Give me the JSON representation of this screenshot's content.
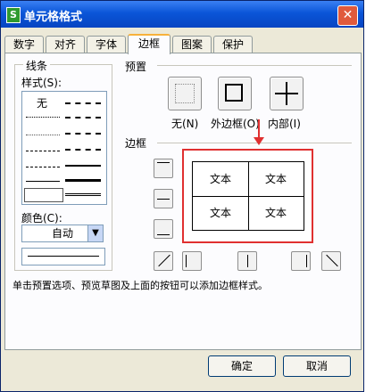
{
  "window": {
    "title": "单元格格式",
    "app_icon": "S"
  },
  "tabs": [
    "数字",
    "对齐",
    "字体",
    "边框",
    "图案",
    "保护"
  ],
  "line_group": {
    "title": "线条",
    "style_label": "样式(S):",
    "none_label": "无",
    "color_label": "颜色(C):",
    "color_value": "自动"
  },
  "presets": {
    "title": "预置",
    "none": "无(N)",
    "outline": "外边框(O)",
    "inside": "内部(I)"
  },
  "border_group": {
    "title": "边框"
  },
  "preview": {
    "cells": [
      "文本",
      "文本",
      "文本",
      "文本"
    ]
  },
  "hint": "单击预置选项、预览草图及上面的按钮可以添加边框样式。",
  "buttons": {
    "ok": "确定",
    "cancel": "取消"
  },
  "colors": {
    "highlight": "#e03030",
    "titlebar": "#0a55d8"
  }
}
